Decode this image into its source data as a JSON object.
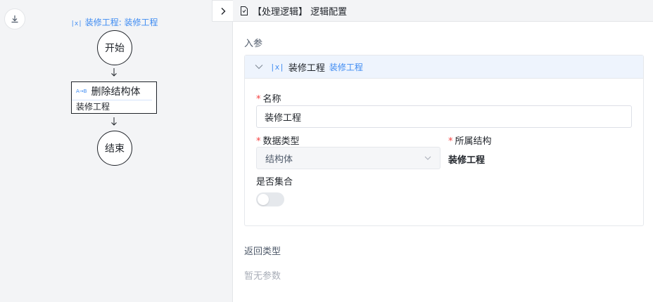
{
  "canvas": {
    "header_tag": "装修工程: 装修工程",
    "start_node": "开始",
    "action_node": {
      "title": "删除结构体",
      "subtitle": "装修工程"
    },
    "end_node": "结束"
  },
  "panel": {
    "title": "【处理逻辑】 逻辑配置",
    "input_section": "入参",
    "param": {
      "name": "装修工程",
      "type": "装修工程",
      "fields": {
        "name_label": "名称",
        "name_value": "装修工程",
        "datatype_label": "数据类型",
        "datatype_value": "结构体",
        "struct_label": "所属结构",
        "struct_value": "装修工程",
        "collection_label": "是否集合",
        "collection_on": false
      }
    },
    "return_section": "返回类型",
    "return_empty": "暂无参数"
  },
  "colors": {
    "accent": "#3e8bf2",
    "required": "#f53f3f",
    "canvas_bg": "#f3f4f6",
    "card_head_bg": "#eef4fd"
  }
}
